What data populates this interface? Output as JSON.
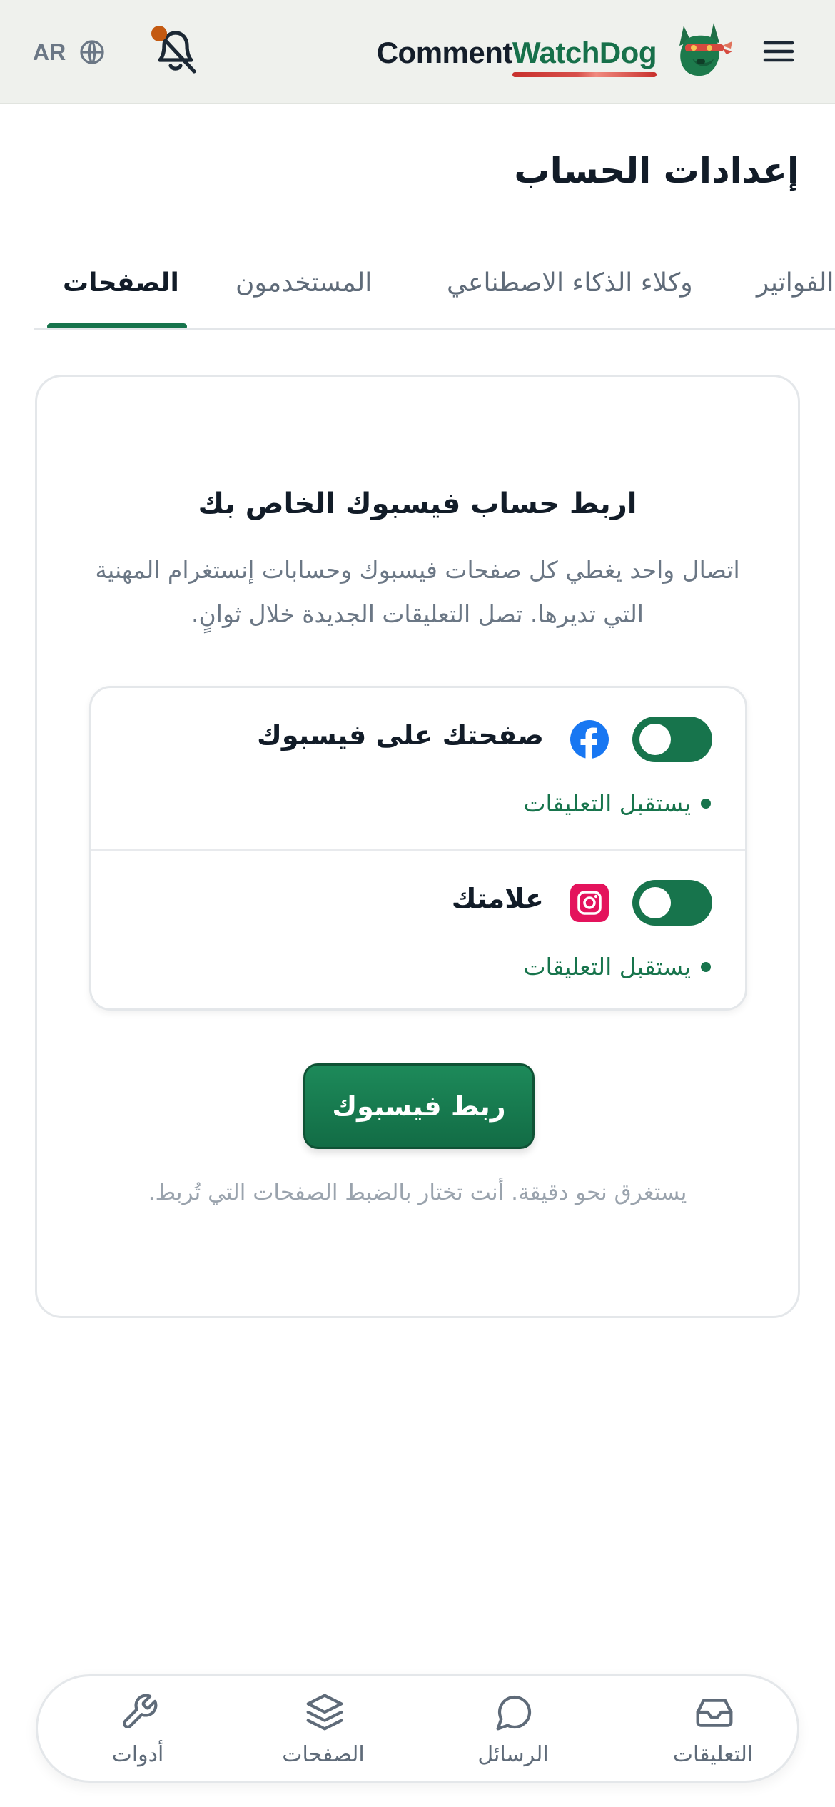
{
  "header": {
    "language": "AR",
    "brand_part1": "Comment",
    "brand_part2": "WatchDog",
    "brand_color": "#17704a",
    "notification_indicator_color": "#c45a11",
    "icons": [
      "globe-icon",
      "bell-off-icon",
      "dog-mascot-logo",
      "menu-icon"
    ]
  },
  "page_title": "إعدادات الحساب",
  "tabs": [
    {
      "label": "الصفحات",
      "active": true
    },
    {
      "label": "المستخدمون",
      "active": false
    },
    {
      "label": "وكلاء الذكاء الاصطناعي",
      "active": false
    },
    {
      "label": "الفواتير",
      "active": false
    }
  ],
  "card": {
    "title": "اربط حساب فيسبوك الخاص بك",
    "description": "اتصال واحد يغطي كل صفحات فيسبوك وحسابات إنستغرام المهنية التي تديرها. تصل التعليقات الجديدة خلال ثوانٍ.",
    "accounts": [
      {
        "name": "صفحتك على فيسبوك",
        "platform_icon": "facebook-icon",
        "enabled": true,
        "status": "يستقبل التعليقات"
      },
      {
        "name": "علامتك",
        "platform_icon": "instagram-icon",
        "enabled": true,
        "status": "يستقبل التعليقات"
      }
    ],
    "connect_button": "ربط فيسبوك",
    "note": "يستغرق نحو دقيقة. أنت تختار بالضبط الصفحات التي تُربط."
  },
  "bottom_nav": [
    {
      "label": "التعليقات",
      "icon": "inbox-icon"
    },
    {
      "label": "الرسائل",
      "icon": "chat-bubble-icon"
    },
    {
      "label": "الصفحات",
      "icon": "layers-icon"
    },
    {
      "label": "أدوات",
      "icon": "wrench-icon"
    }
  ],
  "colors": {
    "accent": "#17744c",
    "header_bg": "#eff1ed",
    "facebook": "#1877f2",
    "instagram": "#e4135c"
  }
}
